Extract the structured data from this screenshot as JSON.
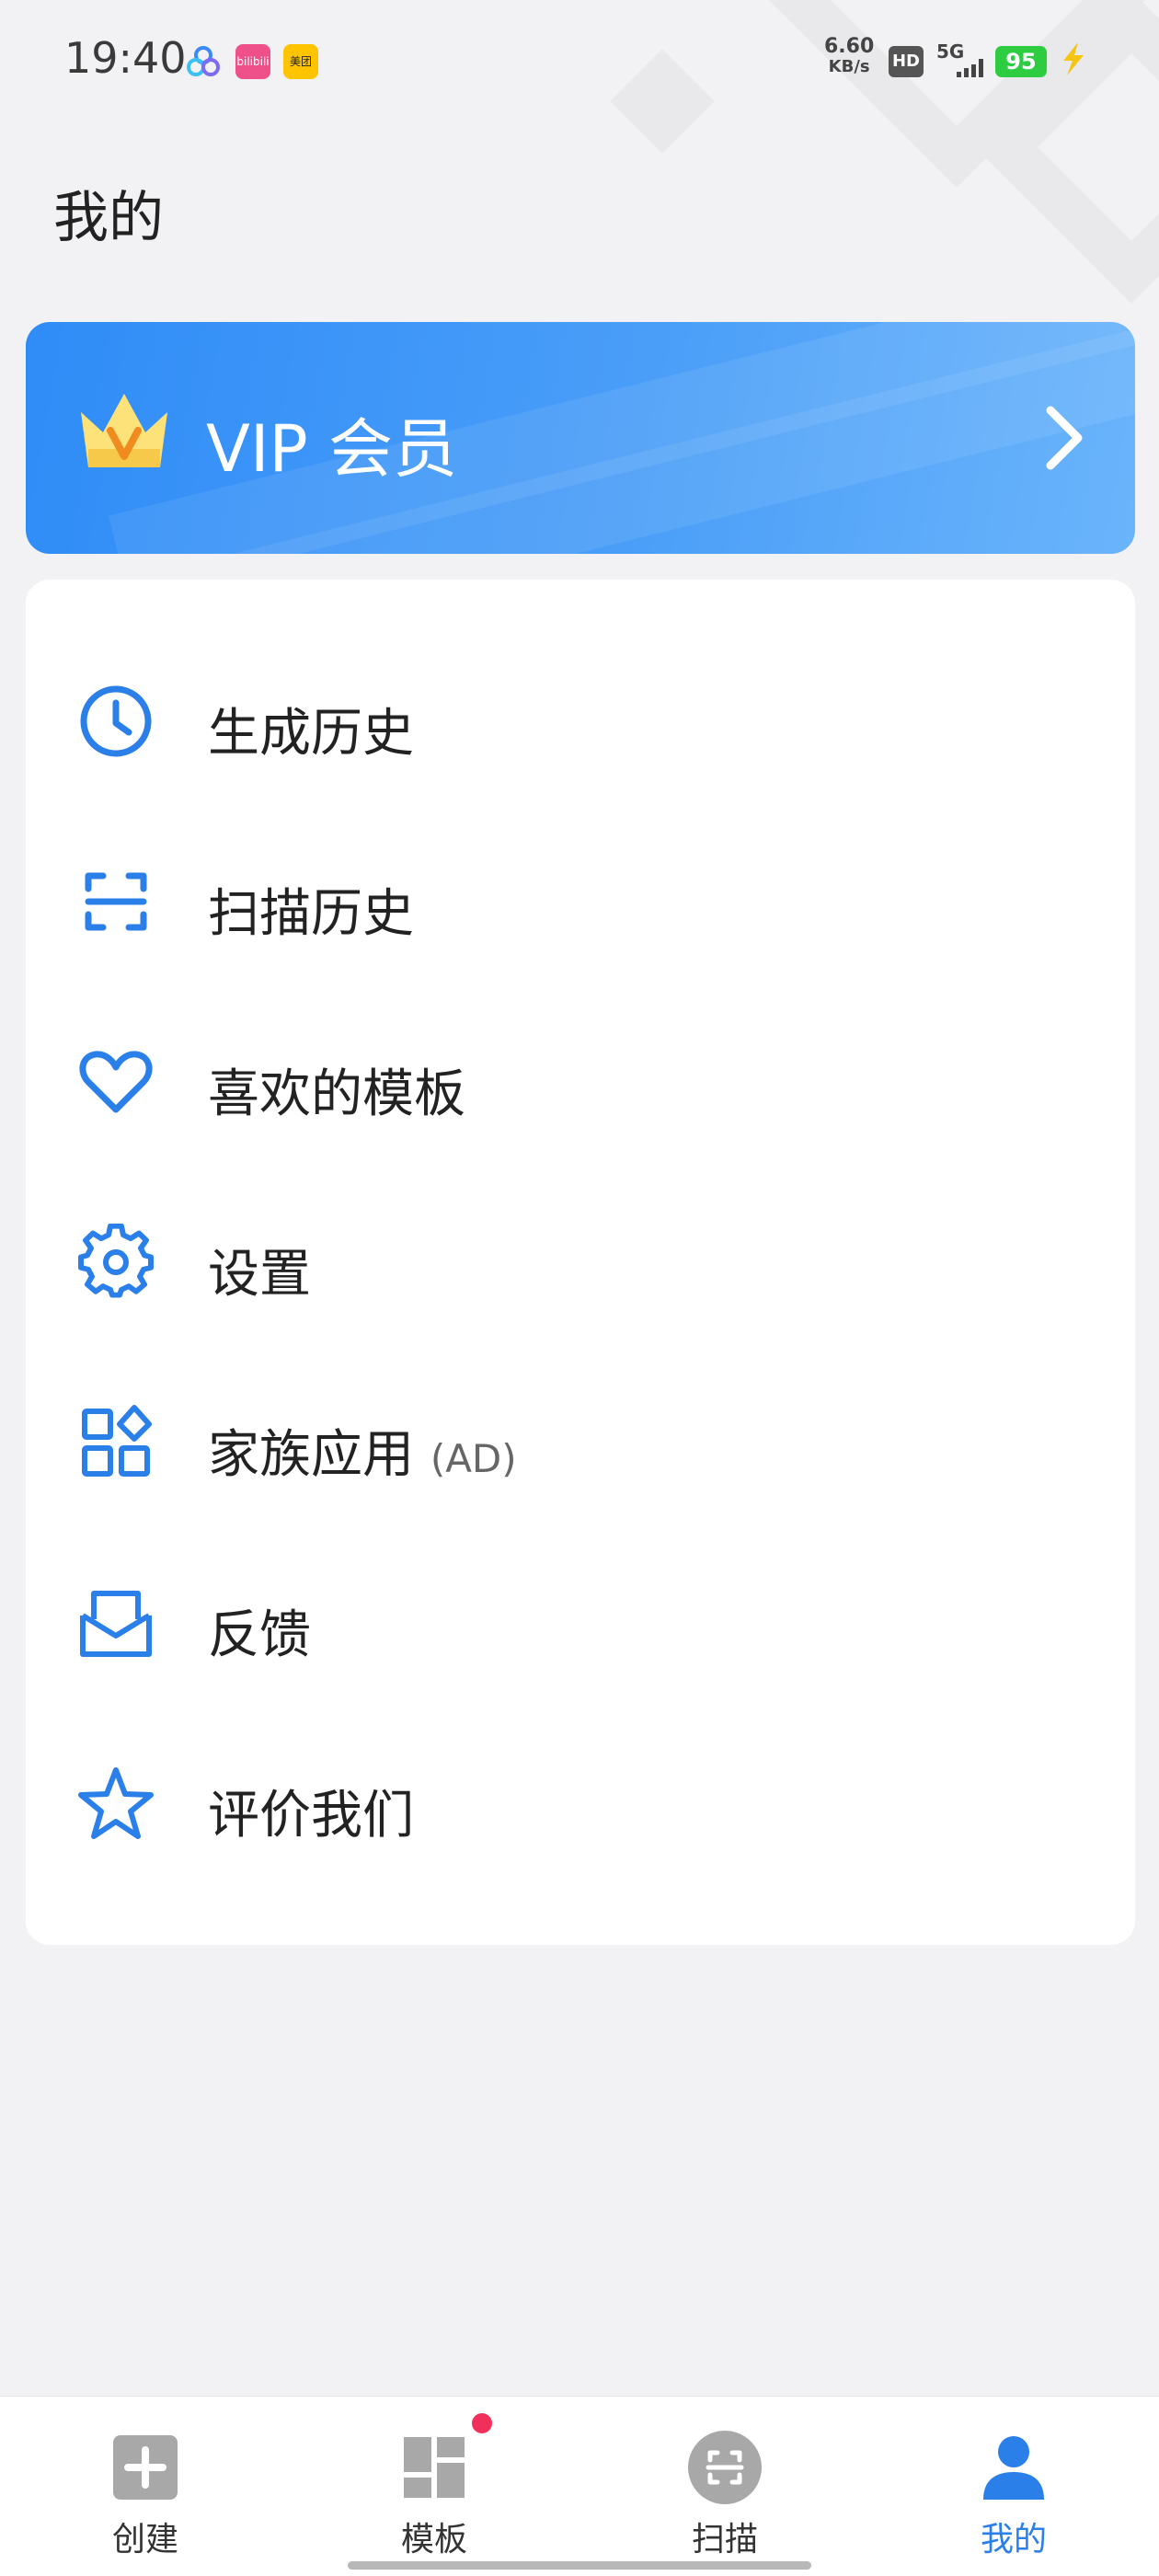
{
  "status_bar": {
    "time": "19:40",
    "app_icons": [
      "baidu-netdisk-icon",
      "bilibili-icon",
      "meituan-icon"
    ],
    "app2_text": "bilibili",
    "app3_text": "美团",
    "net_speed_value": "6.60",
    "net_speed_unit": "KB/s",
    "hd_badge": "HD",
    "signal_label": "5G",
    "battery": "95"
  },
  "page": {
    "title": "我的"
  },
  "vip": {
    "label": "VIP 会员",
    "icon": "crown-icon"
  },
  "menu": {
    "items": [
      {
        "label": "生成历史",
        "icon": "clock-icon"
      },
      {
        "label": "扫描历史",
        "icon": "scan-frame-icon"
      },
      {
        "label": "喜欢的模板",
        "icon": "heart-icon"
      },
      {
        "label": "设置",
        "icon": "gear-icon"
      },
      {
        "label": "家族应用",
        "suffix": "(AD)",
        "icon": "apps-grid-icon"
      },
      {
        "label": "反馈",
        "icon": "envelope-icon"
      },
      {
        "label": "评价我们",
        "icon": "star-icon"
      }
    ]
  },
  "bottom_nav": {
    "items": [
      {
        "label": "创建",
        "icon": "plus-square-icon",
        "active": false
      },
      {
        "label": "模板",
        "icon": "template-grid-icon",
        "active": false,
        "badge_dot": true
      },
      {
        "label": "扫描",
        "icon": "scan-circle-icon",
        "active": false
      },
      {
        "label": "我的",
        "icon": "person-icon",
        "active": true
      }
    ]
  },
  "colors": {
    "accent": "#2b7fe8",
    "vip_gradient_start": "#2f8cf7",
    "vip_gradient_end": "#6ab4fb",
    "background": "#f2f2f5",
    "icon_gray": "#a8a8a8",
    "badge_red": "#f0305a"
  }
}
